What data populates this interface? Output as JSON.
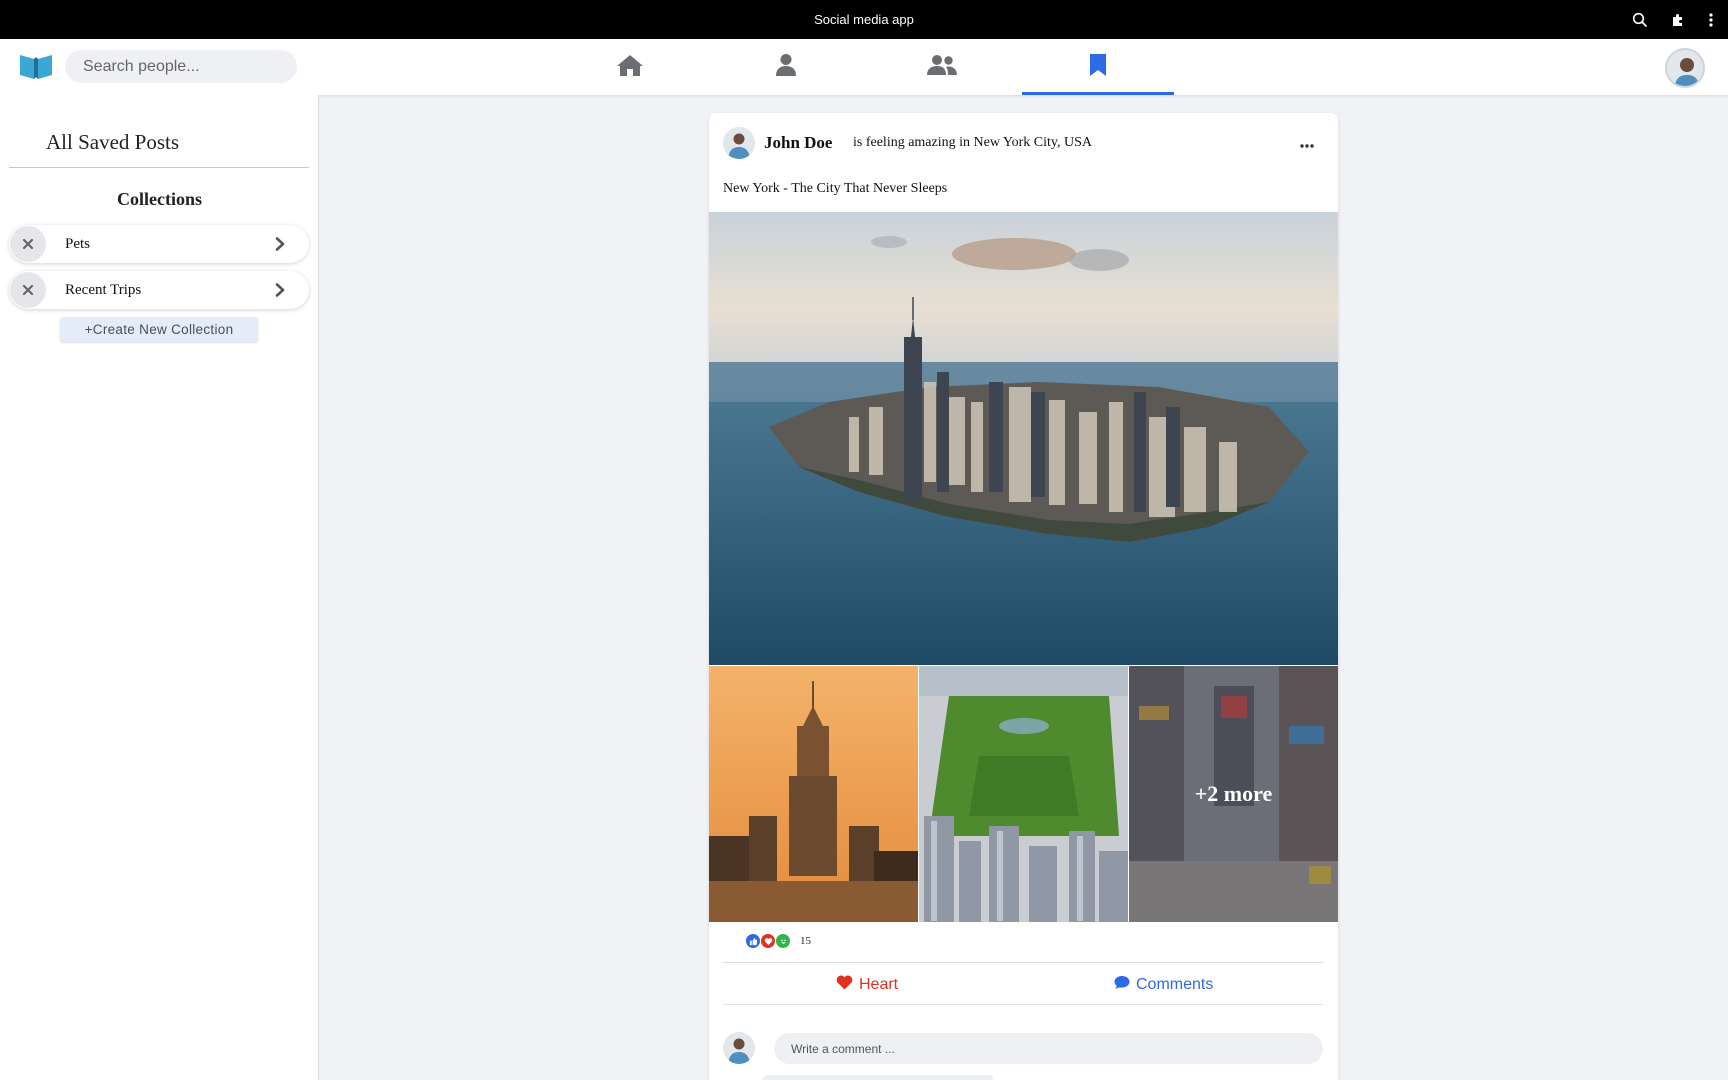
{
  "window": {
    "title": "Social media app"
  },
  "nav": {
    "search_placeholder": "Search people...",
    "tabs": [
      {
        "name": "home",
        "icon": "home-icon"
      },
      {
        "name": "profile",
        "icon": "user-icon"
      },
      {
        "name": "friends",
        "icon": "users-icon"
      },
      {
        "name": "saved",
        "icon": "bookmark-icon",
        "active": true
      }
    ]
  },
  "sidebar": {
    "title": "All Saved Posts",
    "collections_heading": "Collections",
    "collections": [
      {
        "label": "Pets"
      },
      {
        "label": "Recent Trips"
      }
    ],
    "create_label": "+Create New Collection"
  },
  "post": {
    "author": "John Doe",
    "feeling": "is feeling amazing in New York City, USA",
    "caption": "New York - The City That Never Sleeps",
    "more_photos_label": "+2 more",
    "reaction_count": "15",
    "heart_label": "Heart",
    "comments_label": "Comments",
    "comment_placeholder": "Write a comment ..."
  },
  "colors": {
    "accent": "#2d6be4",
    "heart": "#e0321f",
    "comments": "#2d6be4"
  }
}
